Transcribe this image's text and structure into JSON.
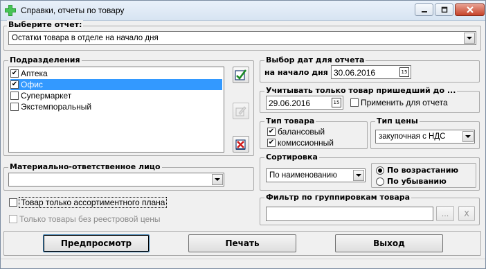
{
  "window": {
    "title": "Справки, отчеты по товару",
    "minimize_glyph": "—",
    "restore_glyph": "▭",
    "close_glyph": "✕"
  },
  "report": {
    "group_title": "Выберите отчет:",
    "selected": "Остатки товара в отделе на начало дня"
  },
  "departments": {
    "group_title": "Подразделения",
    "items": [
      {
        "label": "Аптека",
        "checked": true,
        "selected": false
      },
      {
        "label": "Офис",
        "checked": true,
        "selected": true
      },
      {
        "label": "Супермаркет",
        "checked": false,
        "selected": false
      },
      {
        "label": "Экстемпоральный",
        "checked": false,
        "selected": false
      }
    ]
  },
  "responsible": {
    "group_title": "Материально-ответственное лицо",
    "selected": ""
  },
  "options": {
    "assortment_only": "Товар только ассортиментного плана",
    "no_registry_price": "Только товары без реестровой цены"
  },
  "dates": {
    "group_title": "Выбор дат для отчета",
    "start_label": "на начало дня",
    "start_value": "30.06.2016",
    "calendar_glyph": "15"
  },
  "arrived": {
    "group_title": "Учитывать только товар пришедший до ...",
    "date_value": "29.06.2016",
    "apply_label": "Применить для отчета"
  },
  "goods_type": {
    "group_title": "Тип товара",
    "balance_label": "балансовый",
    "commission_label": "комиссионный"
  },
  "price_type": {
    "group_title": "Тип цены",
    "selected": "закупочная с НДС"
  },
  "sorting": {
    "group_title": "Сортировка",
    "selected": "По наименованию",
    "ascending_label": "По возрастанию",
    "descending_label": "По убыванию"
  },
  "filter": {
    "group_title": "Фильтр по группировкам товара",
    "value": "",
    "browse_label": "...",
    "clear_label": "X"
  },
  "actions": {
    "preview": "Предпросмотр",
    "print": "Печать",
    "exit": "Выход"
  },
  "colors": {
    "selection": "#3399ff",
    "window_bg": "#f0f0f0"
  }
}
